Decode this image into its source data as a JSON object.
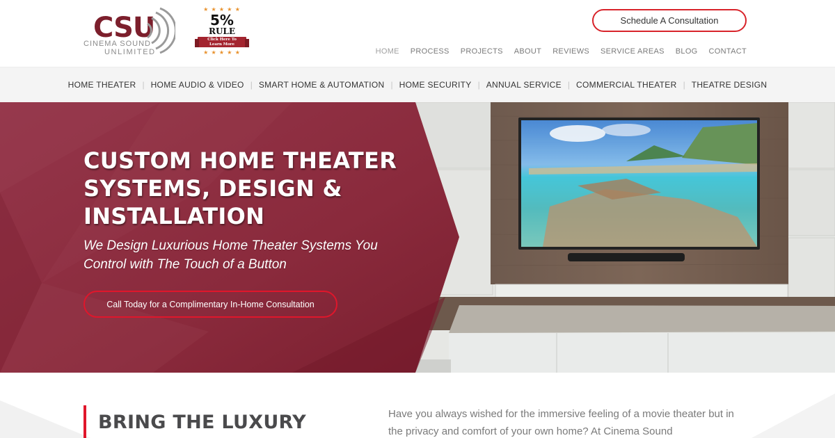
{
  "brand": {
    "logo_main": "CSU",
    "logo_line1": "CINEMA SOUND",
    "logo_line2": "UNLIMITED",
    "primary_color": "#7c1f2c",
    "accent_red": "#e0162b"
  },
  "promo_badge": {
    "stars_top": "★ ★ ★ ★ ★",
    "headline": "5%",
    "subhead": "RULE",
    "ribbon_line1": "Click Here To",
    "ribbon_line2": "Learn More",
    "stars_bottom": "★ ★ ★ ★ ★"
  },
  "header": {
    "cta_label": "Schedule A Consultation",
    "nav": [
      {
        "label": "HOME",
        "active": true
      },
      {
        "label": "PROCESS",
        "active": false
      },
      {
        "label": "PROJECTS",
        "active": false
      },
      {
        "label": "ABOUT",
        "active": false
      },
      {
        "label": "REVIEWS",
        "active": false
      },
      {
        "label": "SERVICE AREAS",
        "active": false
      },
      {
        "label": "BLOG",
        "active": false
      },
      {
        "label": "CONTACT",
        "active": false
      }
    ]
  },
  "services_nav": {
    "separator": "|",
    "items": [
      "HOME THEATER",
      "HOME AUDIO & VIDEO",
      "SMART HOME & AUTOMATION",
      "HOME SECURITY",
      "ANNUAL SERVICE",
      "COMMERCIAL THEATER",
      "THEATRE DESIGN"
    ]
  },
  "hero": {
    "title": "CUSTOM HOME THEATER SYSTEMS, DESIGN & INSTALLATION",
    "subtitle": "We Design Luxurious Home Theater Systems You Control with The Touch of a Button",
    "cta_label": "Call Today for a Complimentary In-Home Consultation",
    "image_description": "wall-mounted-tv-on-wood-panel-with-soundbar"
  },
  "intro_section": {
    "heading": "BRING THE LUXURY",
    "paragraph": "Have you always wished for the immersive feeling of a movie theater but in the privacy and comfort of your own home? At Cinema Sound"
  }
}
